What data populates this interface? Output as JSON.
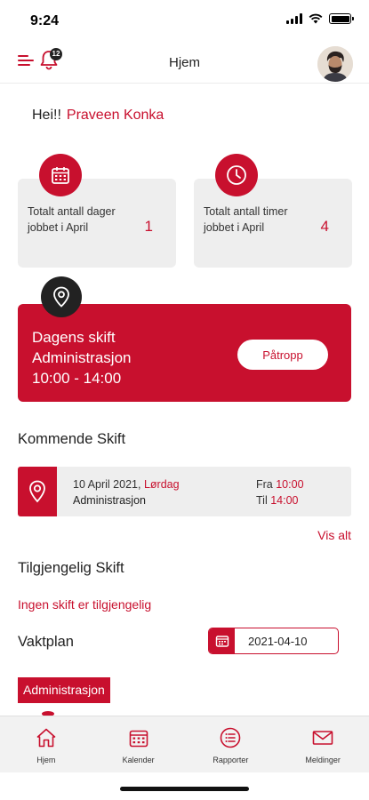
{
  "status_bar": {
    "time": "9:24"
  },
  "header": {
    "title": "Hjem",
    "notification_count": "12"
  },
  "greeting": {
    "prefix": "Hei!!",
    "name": "Praveen Konka"
  },
  "stats": [
    {
      "label": "Totalt antall dager jobbet i April",
      "value": "1",
      "icon": "calendar-icon"
    },
    {
      "label": "Totalt antall timer jobbet i April",
      "value": "4",
      "icon": "clock-icon"
    }
  ],
  "today_shift": {
    "title": "Dagens skift",
    "department": "Administrasjon",
    "time": "10:00 - 14:00",
    "button_label": "Påtropp"
  },
  "upcoming": {
    "section_title": "Kommende Skift",
    "date": "10 April 2021,",
    "weekday": "Lørdag",
    "department": "Administrasjon",
    "from_label": "Fra",
    "from_time": "10:00",
    "to_label": "Til",
    "to_time": "14:00",
    "see_all": "Vis alt"
  },
  "available": {
    "section_title": "Tilgjengelig Skift",
    "empty_message": "Ingen skift er tilgjengelig"
  },
  "schedule": {
    "section_title": "Vaktplan",
    "date": "2021-04-10",
    "department": "Administrasjon"
  },
  "bottom_nav": [
    {
      "label": "Hjem",
      "icon": "home-icon"
    },
    {
      "label": "Kalender",
      "icon": "calendar-icon"
    },
    {
      "label": "Rapporter",
      "icon": "reports-icon"
    },
    {
      "label": "Meldinger",
      "icon": "mail-icon"
    }
  ],
  "colors": {
    "accent": "#c8102e",
    "dark": "#222222",
    "card_bg": "#eeeeee"
  }
}
